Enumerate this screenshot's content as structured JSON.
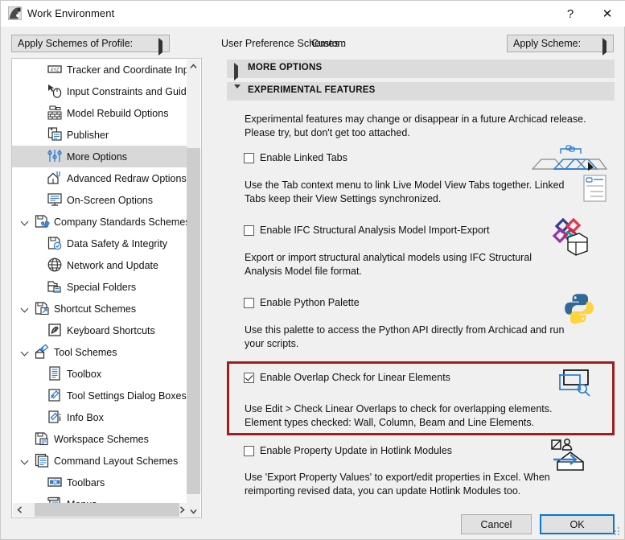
{
  "window": {
    "title": "Work Environment",
    "app_icon": "archicad-logo-icon",
    "help_label": "?",
    "close_label": "✕"
  },
  "toolbar": {
    "profile_button_label": "Apply Schemes of Profile:",
    "user_pref_label": "User Preference Schemes :",
    "user_pref_value": "Custom",
    "apply_scheme_label": "Apply Scheme:"
  },
  "sidebar": {
    "items": [
      {
        "label": "Tracker and Coordinate Input",
        "icon": "xyz-tracker-icon",
        "indent": 2,
        "expander": "none",
        "selected": false
      },
      {
        "label": "Input Constraints and Guides",
        "icon": "mouse-cursor-icon",
        "indent": 2,
        "expander": "none",
        "selected": false
      },
      {
        "label": "Model Rebuild Options",
        "icon": "brick-wall-icon",
        "indent": 2,
        "expander": "none",
        "selected": false
      },
      {
        "label": "Publisher",
        "icon": "publisher-icon",
        "indent": 2,
        "expander": "none",
        "selected": false
      },
      {
        "label": "More Options",
        "icon": "sliders-icon",
        "indent": 2,
        "expander": "none",
        "selected": true
      },
      {
        "label": "Advanced Redraw Options",
        "icon": "house-redraw-icon",
        "indent": 2,
        "expander": "none",
        "selected": false
      },
      {
        "label": "On-Screen Options",
        "icon": "monitor-icon",
        "indent": 2,
        "expander": "none",
        "selected": false
      },
      {
        "label": "Company Standards Schemes",
        "icon": "company-standards-icon",
        "indent": 1,
        "expander": "expanded",
        "selected": false
      },
      {
        "label": "Data Safety & Integrity",
        "icon": "data-safety-icon",
        "indent": 2,
        "expander": "none",
        "selected": false
      },
      {
        "label": "Network and Update",
        "icon": "globe-icon",
        "indent": 2,
        "expander": "none",
        "selected": false
      },
      {
        "label": "Special Folders",
        "icon": "folder-icon",
        "indent": 2,
        "expander": "none",
        "selected": false
      },
      {
        "label": "Shortcut Schemes",
        "icon": "shortcut-schemes-icon",
        "indent": 1,
        "expander": "expanded",
        "selected": false
      },
      {
        "label": "Keyboard Shortcuts",
        "icon": "keyboard-shortcut-icon",
        "indent": 2,
        "expander": "none",
        "selected": false
      },
      {
        "label": "Tool Schemes",
        "icon": "tool-schemes-icon",
        "indent": 1,
        "expander": "expanded",
        "selected": false
      },
      {
        "label": "Toolbox",
        "icon": "toolbox-list-icon",
        "indent": 2,
        "expander": "none",
        "selected": false
      },
      {
        "label": "Tool Settings Dialog Boxes",
        "icon": "tool-settings-icon",
        "indent": 2,
        "expander": "none",
        "selected": false
      },
      {
        "label": "Info Box",
        "icon": "info-box-icon",
        "indent": 2,
        "expander": "none",
        "selected": false
      },
      {
        "label": "Workspace Schemes",
        "icon": "workspace-schemes-icon",
        "indent": 1,
        "expander": "none",
        "selected": false
      },
      {
        "label": "Command Layout Schemes",
        "icon": "command-layout-icon",
        "indent": 1,
        "expander": "expanded",
        "selected": false
      },
      {
        "label": "Toolbars",
        "icon": "toolbars-icon",
        "indent": 2,
        "expander": "none",
        "selected": false
      },
      {
        "label": "Menus",
        "icon": "menus-icon",
        "indent": 2,
        "expander": "none",
        "selected": false
      }
    ],
    "scroll_up_glyph": "▲",
    "scroll_down_glyph": "▼",
    "scroll_left_glyph": "◀",
    "scroll_right_glyph": "▶"
  },
  "sections": [
    {
      "name": "MORE OPTIONS",
      "expanded": false
    },
    {
      "name": "EXPERIMENTAL FEATURES",
      "expanded": true
    }
  ],
  "panel": {
    "intro": "Experimental features may change or disappear in a future Archicad release. Please try, but don't get too attached."
  },
  "features": [
    {
      "id": "linked-tabs",
      "label": "Enable Linked Tabs",
      "checked": false,
      "description": "Use the Tab context menu to link Live Model View Tabs together. Linked Tabs keep their View Settings synchronized.",
      "illustration": "linked-tabs-illustration",
      "highlighted": false
    },
    {
      "id": "ifc-structural-analysis",
      "label": "Enable IFC Structural Analysis Model Import-Export",
      "checked": false,
      "description": "Export or import structural analytical models using IFC Structural Analysis Model file format.",
      "illustration": "ifc-structural-analysis-illustration",
      "highlighted": false
    },
    {
      "id": "python-palette",
      "label": "Enable Python Palette",
      "checked": false,
      "description": "Use this palette to access the Python API directly from Archicad and run your scripts.",
      "illustration": "python-logo-illustration",
      "highlighted": false
    },
    {
      "id": "overlap-check",
      "label": "Enable Overlap Check for Linear Elements",
      "checked": true,
      "description": "Use Edit > Check Linear Overlaps to check for overlapping elements.\nElement types checked: Wall, Column, Beam and Line Elements.",
      "illustration": "overlap-check-illustration",
      "highlighted": true
    },
    {
      "id": "property-update-hotlink",
      "label": "Enable Property Update in Hotlink Modules",
      "checked": false,
      "description": "Use 'Export Property Values' to export/edit properties in Excel. When reimporting revised data, you can update Hotlink Modules too.",
      "illustration": "hotlink-property-illustration",
      "highlighted": false
    }
  ],
  "footer": {
    "cancel_label": "Cancel",
    "ok_label": "OK"
  },
  "colors": {
    "highlight_border": "#9d1f1f",
    "accent_blue": "#0078d7",
    "icon_blue": "#2f7fd1",
    "section_bg": "#dcdcdc",
    "selection_bg": "#d8d8d8"
  }
}
